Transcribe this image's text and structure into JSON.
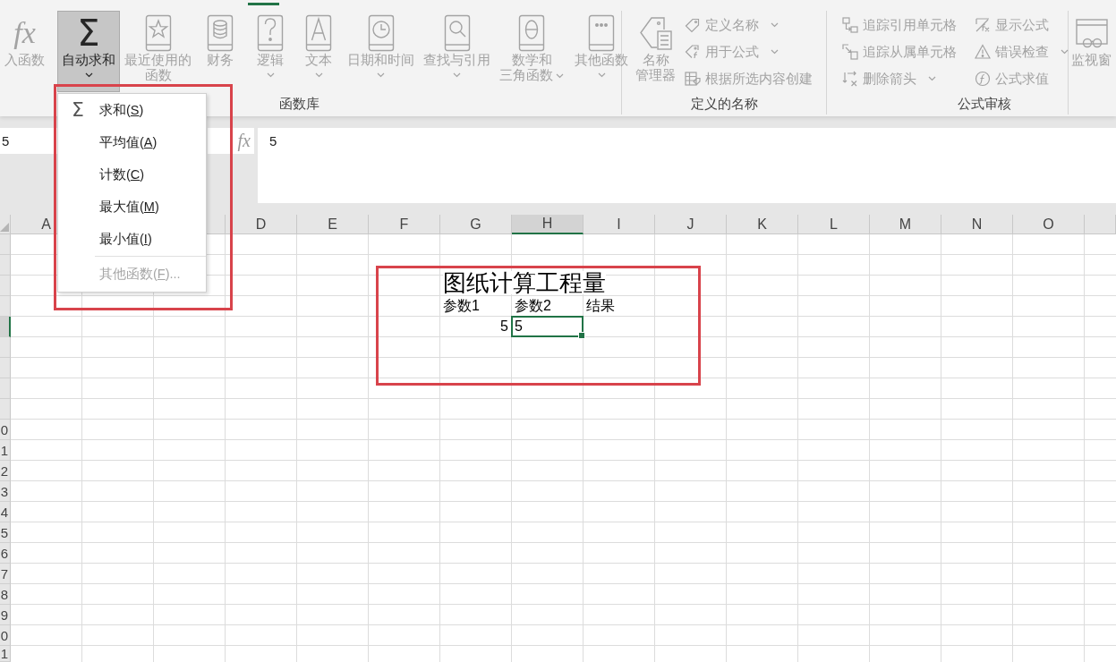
{
  "ribbon": {
    "active_tab_underline": true,
    "groups": [
      {
        "label": "函数库",
        "buttons": [
          {
            "kind": "large",
            "glyph": "fx",
            "lines": [
              "入函数"
            ],
            "disabled": true,
            "pressed": false,
            "dropdown": false
          },
          {
            "kind": "large",
            "glyph": "Σ",
            "lines": [
              "自动求和"
            ],
            "disabled": false,
            "pressed": true,
            "dropdown": true
          },
          {
            "kind": "large",
            "lines": [
              "最近使用的",
              "函数"
            ],
            "disabled": true,
            "pressed": false,
            "dropdown": false
          },
          {
            "kind": "large",
            "lines": [
              "财务"
            ],
            "disabled": true,
            "pressed": false,
            "dropdown": false
          },
          {
            "kind": "large",
            "lines": [
              "逻辑"
            ],
            "disabled": true,
            "pressed": false,
            "dropdown": true
          },
          {
            "kind": "large",
            "lines": [
              "文本"
            ],
            "disabled": true,
            "pressed": false,
            "dropdown": true
          },
          {
            "kind": "large",
            "lines": [
              "日期和时间"
            ],
            "disabled": true,
            "pressed": false,
            "dropdown": true
          },
          {
            "kind": "large",
            "lines": [
              "查找与引用"
            ],
            "disabled": true,
            "pressed": false,
            "dropdown": true
          },
          {
            "kind": "large",
            "lines": [
              "数学和",
              "三角函数"
            ],
            "disabled": true,
            "pressed": false,
            "dropdown": true
          },
          {
            "kind": "large",
            "lines": [
              "其他函数"
            ],
            "disabled": true,
            "pressed": false,
            "dropdown": true
          }
        ]
      },
      {
        "label": "定义的名称",
        "buttons": [
          {
            "kind": "large",
            "lines": [
              "名称",
              "管理器"
            ],
            "disabled": true,
            "pressed": false,
            "dropdown": false
          },
          {
            "kind": "small",
            "label": "定义名称",
            "disabled": true,
            "pressed": false,
            "dropdown": true
          },
          {
            "kind": "small",
            "label": "用于公式",
            "disabled": true,
            "pressed": false,
            "dropdown": true
          },
          {
            "kind": "small",
            "label": "根据所选内容创建",
            "disabled": true,
            "pressed": false,
            "dropdown": false
          }
        ]
      },
      {
        "label": "公式审核",
        "buttons": [
          {
            "kind": "small",
            "label": "追踪引用单元格",
            "disabled": true,
            "pressed": false,
            "dropdown": false
          },
          {
            "kind": "small",
            "label": "追踪从属单元格",
            "disabled": true,
            "pressed": false,
            "dropdown": false
          },
          {
            "kind": "small",
            "label": "删除箭头",
            "disabled": true,
            "pressed": false,
            "dropdown": true
          },
          {
            "kind": "small",
            "label": "显示公式",
            "disabled": true,
            "pressed": false,
            "dropdown": false
          },
          {
            "kind": "small",
            "label": "错误检查",
            "disabled": true,
            "pressed": false,
            "dropdown": true
          },
          {
            "kind": "small",
            "label": "公式求值",
            "disabled": true,
            "pressed": false,
            "dropdown": false
          }
        ]
      },
      {
        "buttons": [
          {
            "kind": "large",
            "lines": [
              "监视窗"
            ],
            "disabled": true,
            "pressed": false,
            "dropdown": false
          }
        ]
      }
    ]
  },
  "formula_bar": {
    "name_box": "5",
    "function_glyph": "fx",
    "value": "5"
  },
  "autosum_menu": {
    "open": true,
    "highlight_frame": true,
    "items": [
      {
        "kind": "command",
        "glyph": "Σ",
        "label_start": "求和(",
        "access_key": "S",
        "label_end": ")",
        "disabled": false
      },
      {
        "kind": "command",
        "label_start": "平均值(",
        "access_key": "A",
        "label_end": ")",
        "disabled": false
      },
      {
        "kind": "command",
        "label_start": "计数(",
        "access_key": "C",
        "label_end": ")",
        "disabled": false
      },
      {
        "kind": "command",
        "label_start": "最大值(",
        "access_key": "M",
        "label_end": ")",
        "disabled": false
      },
      {
        "kind": "command",
        "label_start": "最小值(",
        "access_key": "I",
        "label_end": ")",
        "disabled": false
      },
      {
        "kind": "separator"
      },
      {
        "kind": "command",
        "label_start": "其他函数(",
        "access_key": "F",
        "label_end": ")...",
        "disabled": true
      }
    ]
  },
  "sheet": {
    "highlight_frame": true,
    "columns": [
      {
        "label": "A",
        "selected": false
      },
      null,
      {
        "selected": false
      },
      {
        "label": "D",
        "selected": false
      },
      {
        "label": "E",
        "selected": false
      },
      {
        "label": "F",
        "selected": false
      },
      {
        "label": "G",
        "selected": false
      },
      {
        "label": "H",
        "selected": true
      },
      {
        "label": "I",
        "selected": false
      },
      {
        "label": "J",
        "selected": false
      },
      {
        "label": "K",
        "selected": false
      },
      {
        "label": "L",
        "selected": false
      },
      {
        "label": "M",
        "selected": false
      },
      {
        "label": "N",
        "selected": false
      },
      {
        "label": "O",
        "selected": false
      }
    ],
    "rows": [
      {
        "selected": false
      },
      {
        "selected": false
      },
      {
        "selected": false,
        "cells": [
          null,
          null,
          null,
          null,
          null,
          null,
          {
            "kind": "title",
            "text": "图纸计算工程量",
            "selected": false
          }
        ]
      },
      {
        "selected": false,
        "cells": [
          null,
          null,
          null,
          null,
          null,
          null,
          {
            "kind": "text",
            "text": "参数1",
            "selected": false
          },
          {
            "kind": "text",
            "text": "参数2",
            "selected": false
          },
          {
            "kind": "text",
            "text": "结果",
            "selected": false
          }
        ]
      },
      {
        "selected": true,
        "cells": [
          null,
          null,
          null,
          null,
          null,
          null,
          {
            "kind": "number",
            "text": "5",
            "selected": false
          },
          {
            "kind": "text",
            "text": "5",
            "selected": true
          }
        ]
      },
      {
        "selected": false
      },
      {
        "selected": false
      },
      {
        "selected": false
      },
      {
        "selected": false
      },
      {
        "label": "0",
        "selected": false
      },
      {
        "label": "1",
        "selected": false
      },
      {
        "label": "2",
        "selected": false
      },
      {
        "label": "3",
        "selected": false
      },
      {
        "label": "4",
        "selected": false
      },
      {
        "label": "5",
        "selected": false
      },
      {
        "label": "6",
        "selected": false
      },
      {
        "label": "7",
        "selected": false
      },
      {
        "label": "8",
        "selected": false
      },
      {
        "label": "9",
        "selected": false
      },
      {
        "label": "0",
        "selected": false
      },
      {
        "label": "1",
        "selected": false
      }
    ]
  }
}
